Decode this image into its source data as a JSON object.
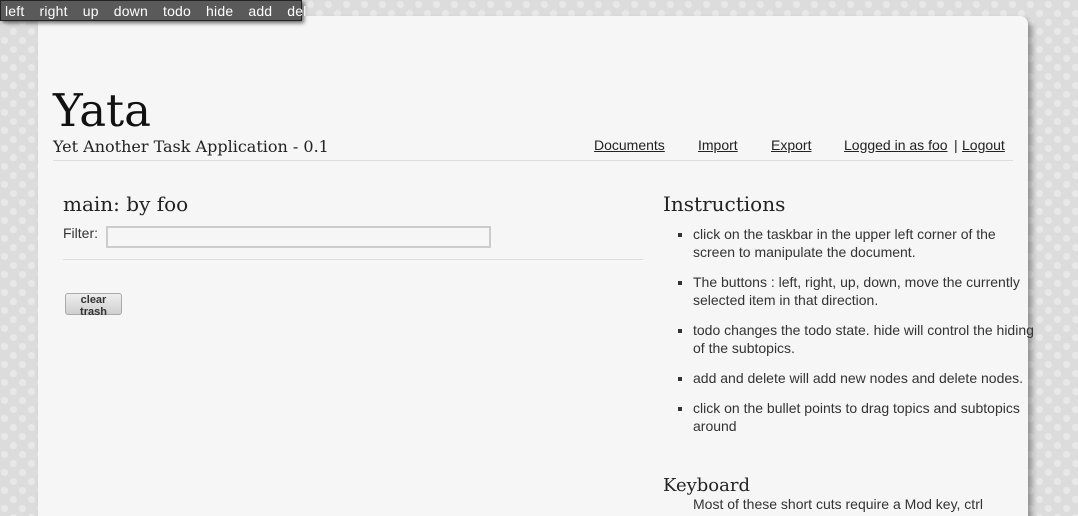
{
  "taskbar": {
    "buttons": [
      "left",
      "right",
      "up",
      "down",
      "todo",
      "hide",
      "add",
      "del"
    ]
  },
  "header": {
    "title": "Yata",
    "subtitle": "Yet Another Task Application - 0.1",
    "nav": {
      "documents": "Documents",
      "import": "Import",
      "export": "Export",
      "logged_in": "Logged in as foo",
      "separator": "|",
      "logout": "Logout"
    }
  },
  "document": {
    "title": "main: by foo",
    "filter_label": "Filter:",
    "filter_value": "",
    "clear_trash_label": "clear trash"
  },
  "instructions": {
    "title": "Instructions",
    "items": [
      "click on the taskbar in the upper left corner of the screen to manipulate the document.",
      "The buttons : left, right, up, down, move the currently selected item in that direction.",
      "todo changes the todo state. hide will control the hiding of the subtopics.",
      "add and delete will add new nodes and delete nodes.",
      "click on the bullet points to drag topics and subtopics around"
    ]
  },
  "keyboard": {
    "title": "Keyboard",
    "text": "Most of these short cuts require a Mod key, ctrl"
  }
}
